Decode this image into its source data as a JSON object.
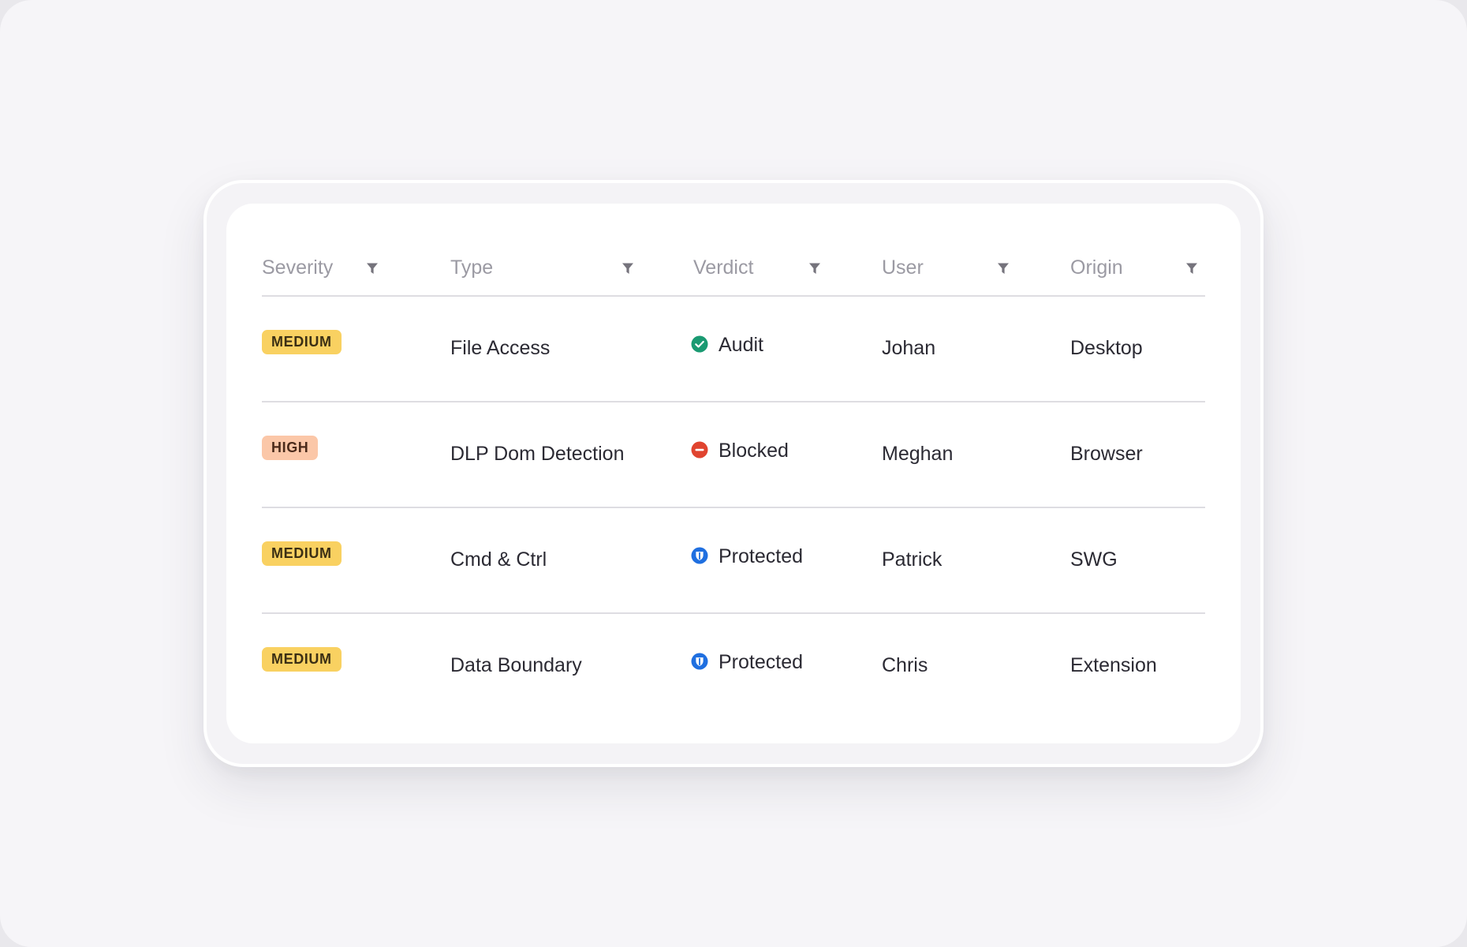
{
  "table": {
    "columns": [
      {
        "key": "severity",
        "label": "Severity",
        "filter_icon": "filter-icon"
      },
      {
        "key": "type",
        "label": "Type",
        "filter_icon": "filter-icon"
      },
      {
        "key": "verdict",
        "label": "Verdict",
        "filter_icon": "filter-icon"
      },
      {
        "key": "user",
        "label": "User",
        "filter_icon": "filter-icon"
      },
      {
        "key": "origin",
        "label": "Origin",
        "filter_icon": "filter-icon"
      }
    ],
    "rows": [
      {
        "severity": "MEDIUM",
        "severity_level": "medium",
        "type": "File Access",
        "verdict": "Audit",
        "verdict_icon": "check-circle-icon",
        "user": "Johan",
        "origin": "Desktop"
      },
      {
        "severity": "HIGH",
        "severity_level": "high",
        "type": "DLP Dom Detection",
        "verdict": "Blocked",
        "verdict_icon": "blocked-circle-icon",
        "user": "Meghan",
        "origin": "Browser"
      },
      {
        "severity": "MEDIUM",
        "severity_level": "medium",
        "type": "Cmd & Ctrl",
        "verdict": "Protected",
        "verdict_icon": "shield-circle-icon",
        "user": "Patrick",
        "origin": "SWG"
      },
      {
        "severity": "MEDIUM",
        "severity_level": "medium",
        "type": "Data Boundary",
        "verdict": "Protected",
        "verdict_icon": "shield-circle-icon",
        "user": "Chris",
        "origin": "Extension"
      }
    ]
  },
  "colors": {
    "medium_badge": "#f9d161",
    "high_badge": "#fbc7a8",
    "audit": "#1a9a72",
    "blocked": "#e0442f",
    "protected": "#1f6fe0"
  }
}
